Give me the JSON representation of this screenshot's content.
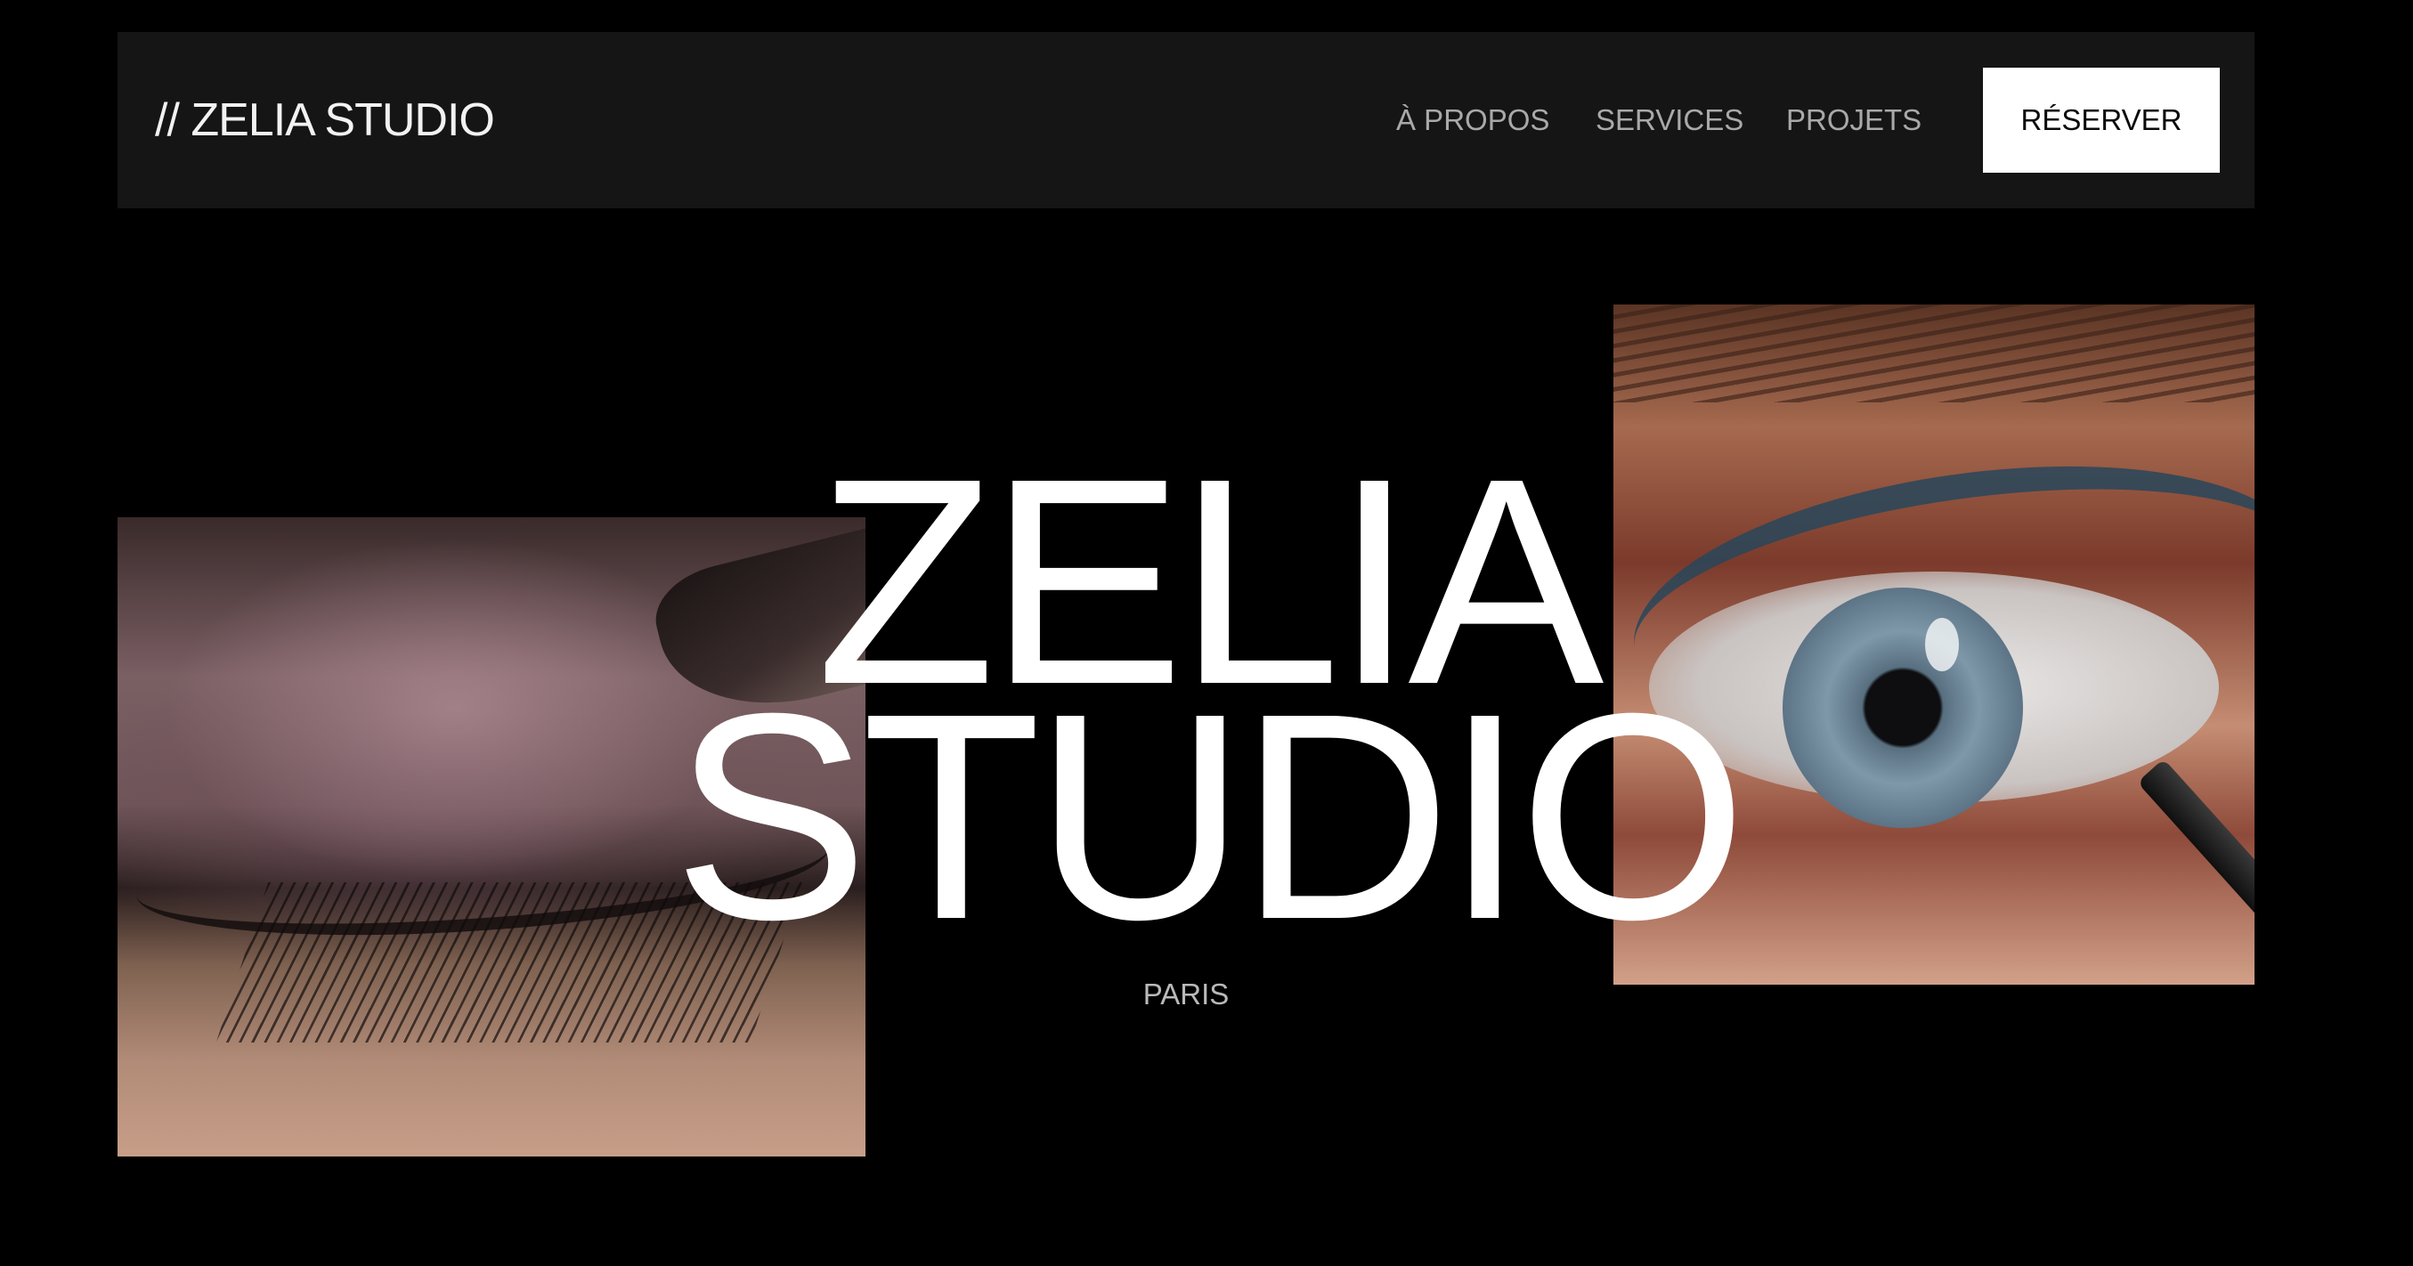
{
  "header": {
    "logo": "// ZELIA STUDIO",
    "nav": [
      {
        "label": "À PROPOS"
      },
      {
        "label": "SERVICES"
      },
      {
        "label": "PROJETS"
      }
    ],
    "cta_label": "RÉSERVER"
  },
  "hero": {
    "title_line1": "ZELIA",
    "title_line2": "STUDIO",
    "location": "PARIS"
  },
  "images": {
    "left": "closed-eye-shimmer-eyeshadow-photo",
    "right": "open-blue-eye-eyeliner-photo"
  },
  "colors": {
    "background": "#000000",
    "header": "#151515",
    "text": "#ffffff",
    "nav_text": "#a9a9a9",
    "cta_bg": "#ffffff",
    "cta_text": "#0a0a0a"
  }
}
